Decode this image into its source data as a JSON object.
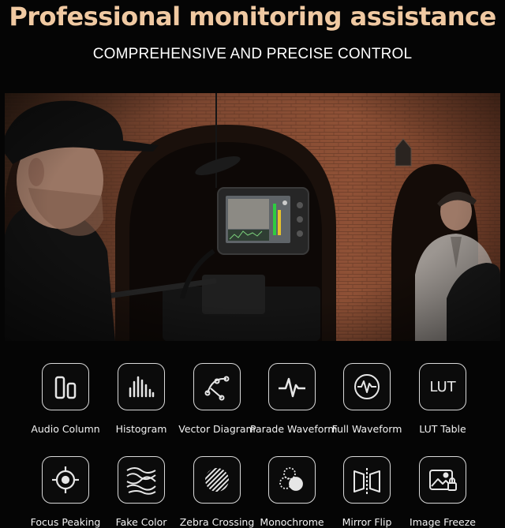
{
  "header": {
    "title": "Professional monitoring assistance",
    "subtitle": "COMPREHENSIVE AND PRECISE CONTROL"
  },
  "colors": {
    "title": "#f0c9a2",
    "brick": "#8a4a30",
    "icon_stroke": "#e6e6e6"
  },
  "features_row1": [
    {
      "label": "Audio Column",
      "icon": "audio-column-icon"
    },
    {
      "label": "Histogram",
      "icon": "histogram-icon"
    },
    {
      "label": "Vector Diagram",
      "icon": "vector-diagram-icon"
    },
    {
      "label": "Parade Waveform",
      "icon": "parade-waveform-icon"
    },
    {
      "label": "Full Waveform",
      "icon": "full-waveform-icon"
    },
    {
      "label": "LUT Table",
      "icon": "lut-table-icon",
      "icon_text": "LUT"
    }
  ],
  "features_row2": [
    {
      "label": "Focus Peaking",
      "icon": "focus-peaking-icon"
    },
    {
      "label": "Fake Color",
      "icon": "fake-color-icon"
    },
    {
      "label": "Zebra Crossing",
      "icon": "zebra-crossing-icon"
    },
    {
      "label": "Monochrome",
      "icon": "monochrome-icon"
    },
    {
      "label": "Mirror Flip",
      "icon": "mirror-flip-icon"
    },
    {
      "label": "Image Freeze",
      "icon": "image-freeze-icon"
    }
  ]
}
